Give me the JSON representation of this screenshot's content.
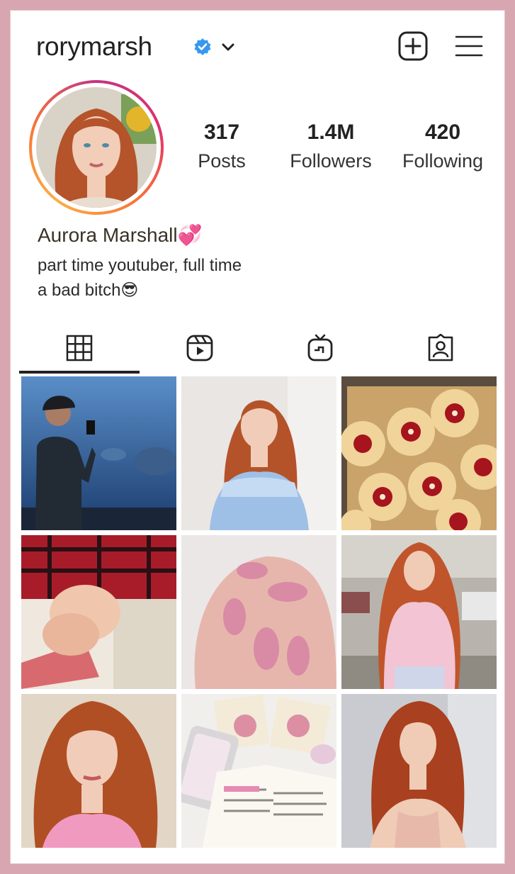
{
  "header": {
    "username": "rorymarsh"
  },
  "icons": {
    "verified": "verified-badge-icon",
    "dropdown": "chevron-down-icon",
    "create": "plus-square-icon",
    "menu": "hamburger-menu-icon"
  },
  "stats": [
    {
      "value": "317",
      "label": "Posts"
    },
    {
      "value": "1.4M",
      "label": "Followers"
    },
    {
      "value": "420",
      "label": "Following"
    }
  ],
  "profile": {
    "display_name": "Aurora Marshall💞",
    "bio_line1": "part time youtuber, full time",
    "bio_line2": "a bad bitch😎"
  },
  "tabs": [
    {
      "name": "grid",
      "icon": "grid-icon",
      "active": true
    },
    {
      "name": "reels",
      "icon": "reels-icon",
      "active": false
    },
    {
      "name": "igtv",
      "icon": "igtv-icon",
      "active": false
    },
    {
      "name": "tagged",
      "icon": "tagged-icon",
      "active": false
    }
  ],
  "colors": {
    "background": "#d8a6b0",
    "verified": "#3897f0",
    "text": "#222222"
  },
  "posts": [
    {
      "subject": "aquarium photo"
    },
    {
      "subject": "blue dress portrait"
    },
    {
      "subject": "jam flower cookies"
    },
    {
      "subject": "holding hands"
    },
    {
      "subject": "pink nails"
    },
    {
      "subject": "pink sweater in parking garage"
    },
    {
      "subject": "pink top portrait"
    },
    {
      "subject": "crochet and book"
    },
    {
      "subject": "satin dress portrait"
    }
  ]
}
